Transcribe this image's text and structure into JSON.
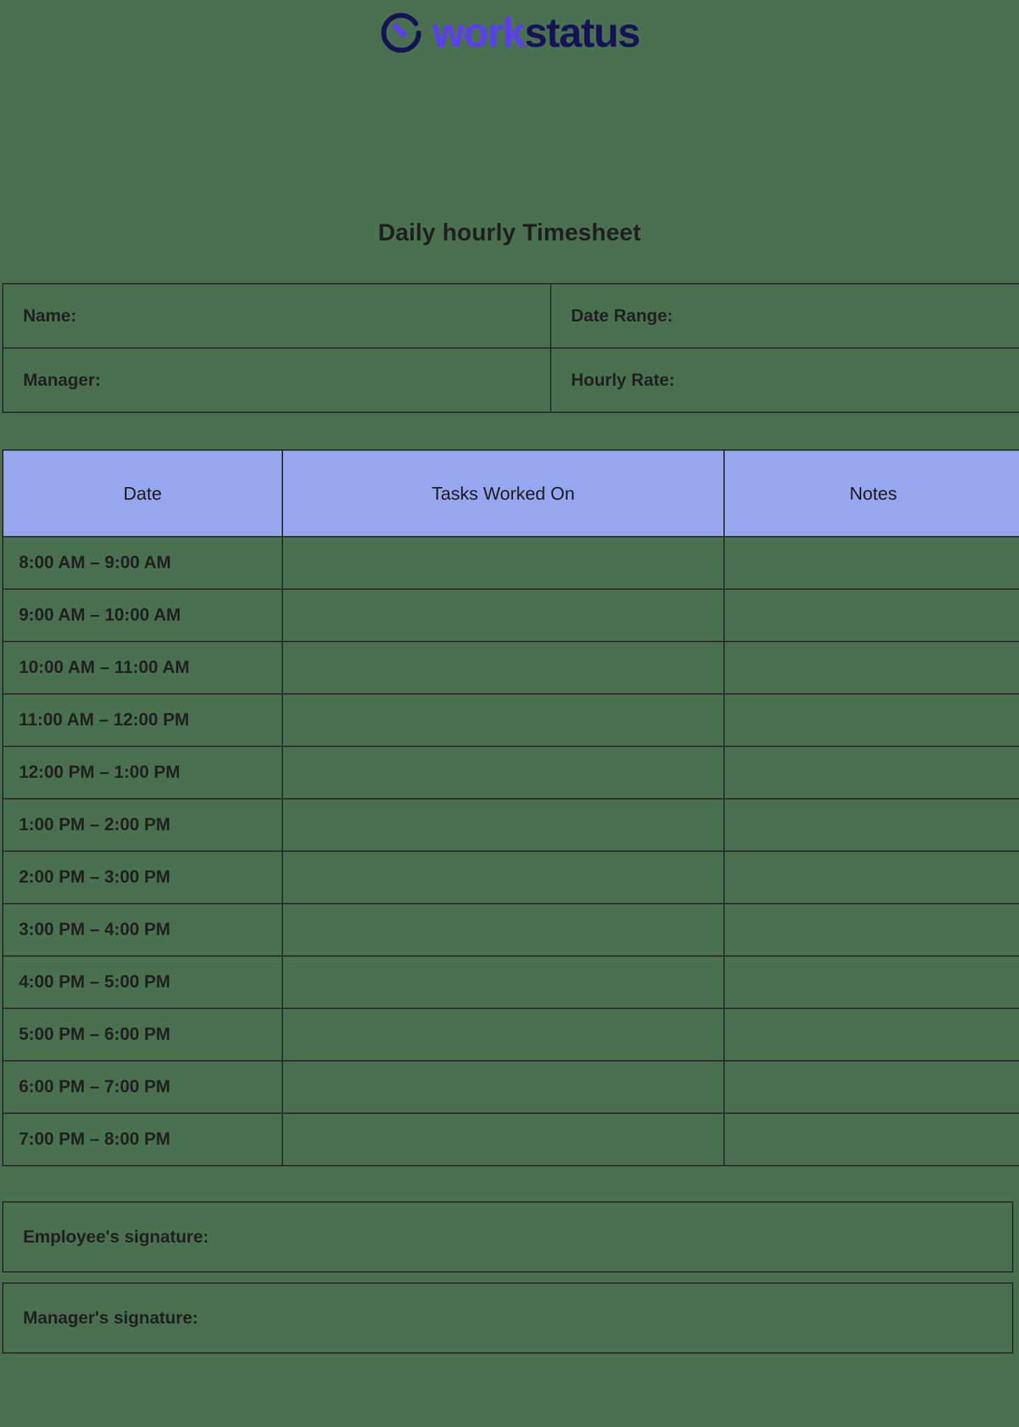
{
  "brand": {
    "icon_name": "clock-icon",
    "name_part_1": "work",
    "name_part_2": "status",
    "color_primary": "#5b3df5",
    "color_secondary": "#131355"
  },
  "document": {
    "title": "Daily hourly Timesheet"
  },
  "info_fields": {
    "name_label": "Name:",
    "date_range_label": "Date Range:",
    "manager_label": "Manager:",
    "hourly_rate_label": "Hourly Rate:"
  },
  "timesheet_table": {
    "header_bg": "#96a7f0",
    "columns": [
      "Date",
      "Tasks Worked On",
      "Notes"
    ],
    "rows": [
      {
        "date": "8:00 AM – 9:00 AM",
        "tasks": "",
        "notes": ""
      },
      {
        "date": "9:00 AM – 10:00 AM",
        "tasks": "",
        "notes": ""
      },
      {
        "date": "10:00 AM – 11:00 AM",
        "tasks": "",
        "notes": ""
      },
      {
        "date": "11:00 AM – 12:00 PM",
        "tasks": "",
        "notes": ""
      },
      {
        "date": "12:00 PM – 1:00 PM",
        "tasks": "",
        "notes": ""
      },
      {
        "date": "1:00 PM – 2:00 PM",
        "tasks": "",
        "notes": ""
      },
      {
        "date": "2:00 PM – 3:00 PM",
        "tasks": "",
        "notes": ""
      },
      {
        "date": "3:00 PM – 4:00 PM",
        "tasks": "",
        "notes": ""
      },
      {
        "date": "4:00 PM – 5:00 PM",
        "tasks": "",
        "notes": ""
      },
      {
        "date": "5:00 PM – 6:00 PM",
        "tasks": "",
        "notes": ""
      },
      {
        "date": "6:00 PM – 7:00 PM",
        "tasks": "",
        "notes": ""
      },
      {
        "date": "7:00 PM – 8:00 PM",
        "tasks": "",
        "notes": ""
      }
    ]
  },
  "signatures": {
    "employee_label": "Employee's signature:",
    "manager_label": "Manager's signature:"
  }
}
